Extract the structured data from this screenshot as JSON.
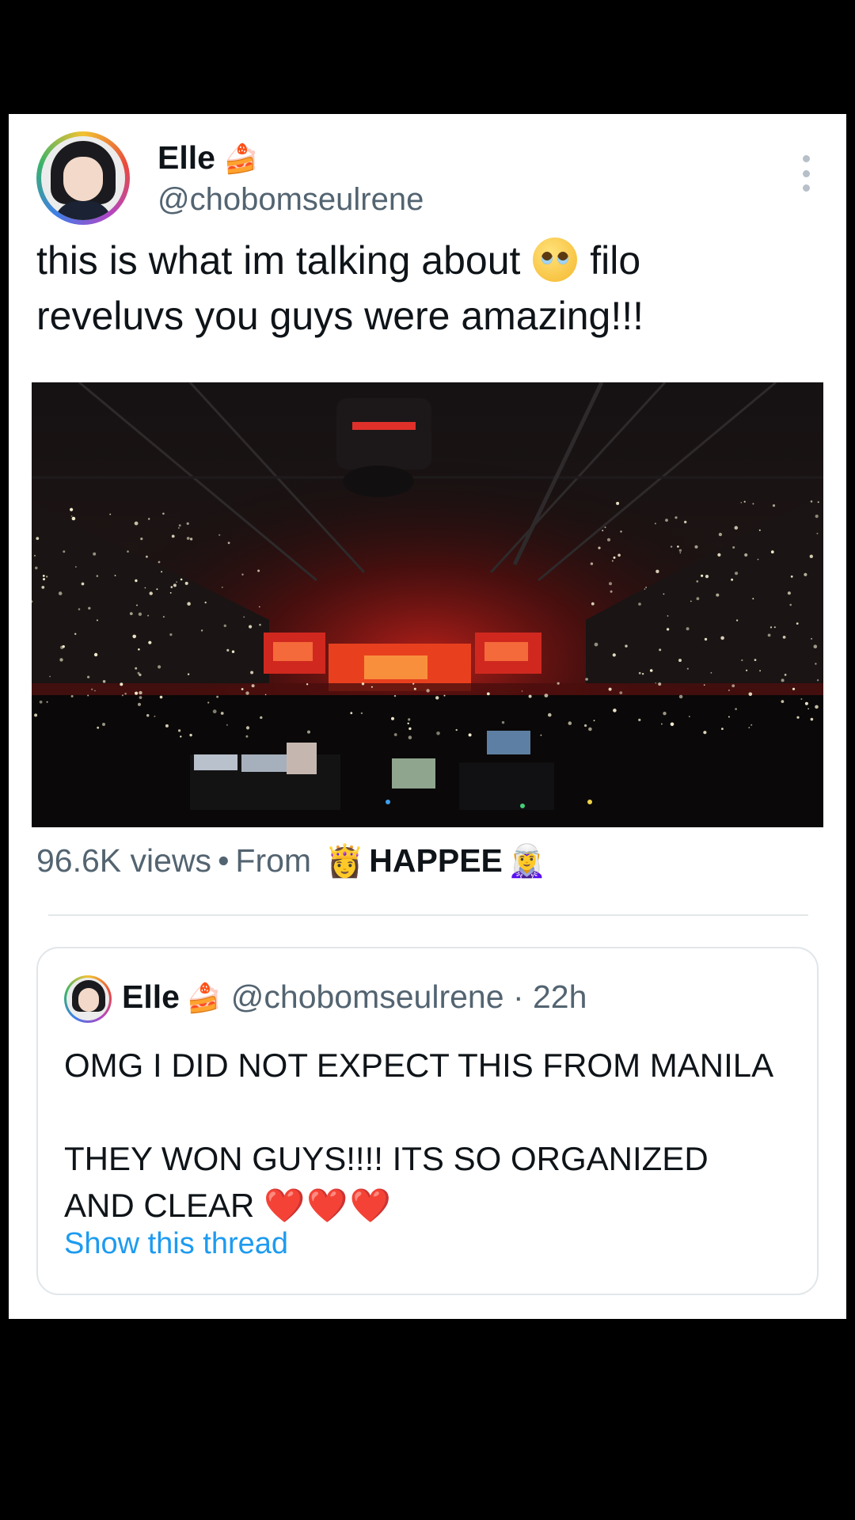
{
  "tweet": {
    "author": {
      "display_name": "Elle",
      "name_emoji": "🍰",
      "handle": "@chobomseulrene"
    },
    "text_line1": "this is what im talking about",
    "text_emoji": "🥹",
    "text_line1_end": "filo",
    "text_line2": "reveluvs you guys were amazing!!!",
    "views": "96.6K views",
    "separator": "•",
    "from_label": "From",
    "app_emoji_left": "👸",
    "app_name": "HAPPEE",
    "app_emoji_right": "🧝‍♀️"
  },
  "quoted_tweet": {
    "display_name": "Elle",
    "name_emoji": "🍰",
    "handle": "@chobomseulrene",
    "dot": "·",
    "time": "22h",
    "text_line1": "OMG I DID NOT EXPECT THIS FROM MANILA",
    "text_line2": "THEY WON GUYS!!!! ITS SO ORGANIZED",
    "text_line3": "AND CLEAR",
    "hearts": "❤️❤️❤️",
    "show_thread": "Show this thread"
  },
  "colors": {
    "text_primary": "#0f1419",
    "text_secondary": "#536471",
    "link": "#1d9bf0",
    "background": "#ffffff",
    "page_background": "#000000"
  },
  "icons": {
    "more": "more-vertical-icon"
  }
}
